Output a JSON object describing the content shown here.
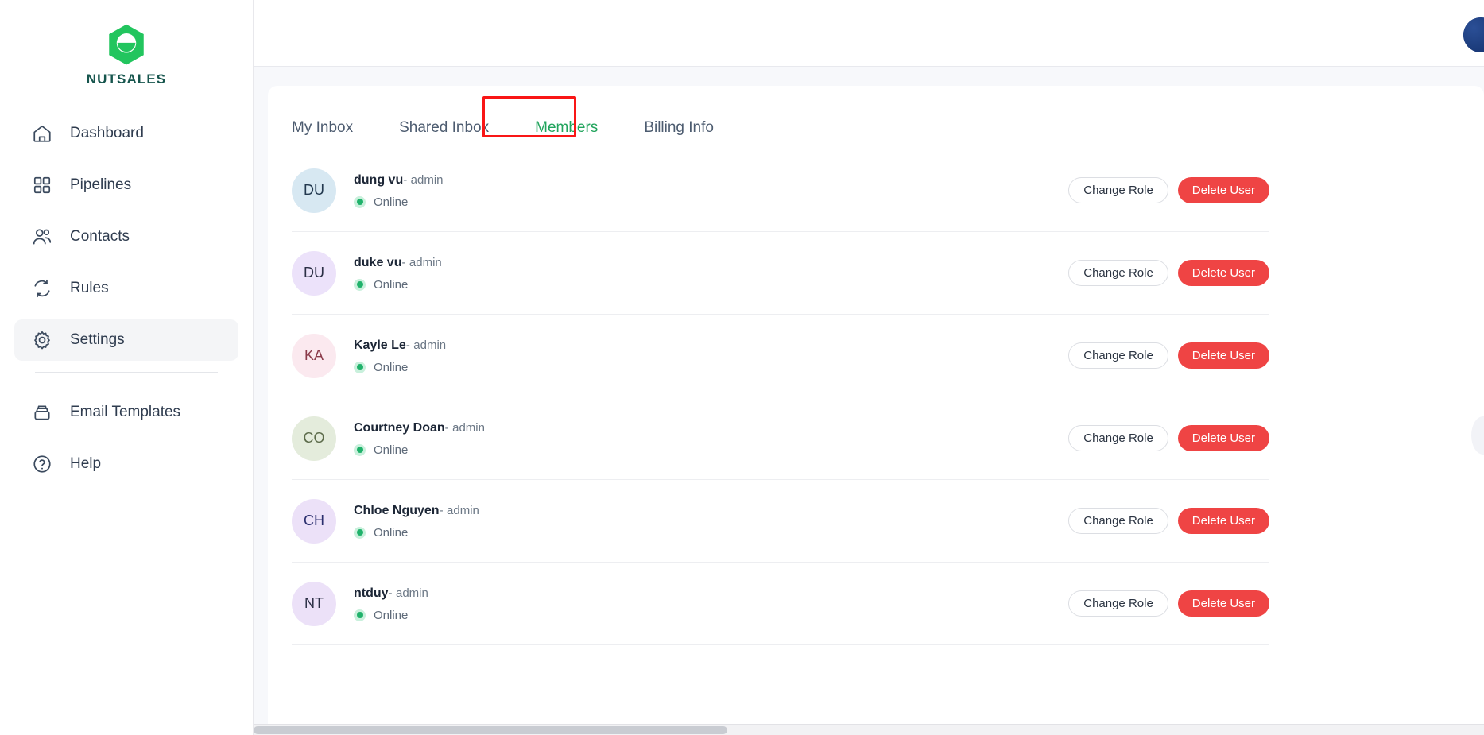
{
  "brand": {
    "name": "NUTSALES",
    "logo_icon": "nutsales-hexagon-logo",
    "accent_color": "#22c55e",
    "wordmark_color": "#16554d"
  },
  "sidebar": {
    "items": [
      {
        "label": "Dashboard",
        "icon": "home-icon",
        "active": false
      },
      {
        "label": "Pipelines",
        "icon": "grid-icon",
        "active": false
      },
      {
        "label": "Contacts",
        "icon": "people-icon",
        "active": false
      },
      {
        "label": "Rules",
        "icon": "refresh-icon",
        "active": false
      },
      {
        "label": "Settings",
        "icon": "gear-icon",
        "active": true
      }
    ],
    "secondary_items": [
      {
        "label": "Email Templates",
        "icon": "inbox-icon",
        "active": false
      },
      {
        "label": "Help",
        "icon": "question-circle-icon",
        "active": false
      }
    ]
  },
  "topbar": {
    "user_avatar_icon": "user-avatar",
    "user_avatar_color": "#1b3a7a"
  },
  "tabs": [
    {
      "label": "My Inbox",
      "active": false
    },
    {
      "label": "Shared Inbox",
      "active": false
    },
    {
      "label": "Members",
      "active": true
    },
    {
      "label": "Billing Info",
      "active": false
    }
  ],
  "annotation": {
    "target_tab": "Members",
    "color": "#f91616",
    "shape": "rectangle"
  },
  "actions": {
    "change_role_label": "Change Role",
    "delete_user_label": "Delete User",
    "delete_color": "#ef4444"
  },
  "status": {
    "online_label": "Online",
    "online_color": "#20b26b",
    "online_halo_color": "#c9f0dc"
  },
  "members": [
    {
      "initials": "DU",
      "name": "dung vu",
      "role_separator": "-",
      "role": "admin",
      "status": "Online",
      "avatar_bg": "#d7e8f2",
      "avatar_fg": "#23394f"
    },
    {
      "initials": "DU",
      "name": "duke vu",
      "role_separator": "-",
      "role": "admin",
      "status": "Online",
      "avatar_bg": "#ece2fa",
      "avatar_fg": "#2b2f45"
    },
    {
      "initials": "KA",
      "name": "Kayle Le",
      "role_separator": "-",
      "role": "admin",
      "status": "Online",
      "avatar_bg": "#fbe9ef",
      "avatar_fg": "#8b3a4a"
    },
    {
      "initials": "CO",
      "name": "Courtney Doan",
      "role_separator": "-",
      "role": "admin",
      "status": "Online",
      "avatar_bg": "#e4ecdc",
      "avatar_fg": "#5c6b4a"
    },
    {
      "initials": "CH",
      "name": "Chloe Nguyen",
      "role_separator": "-",
      "role": "admin",
      "status": "Online",
      "avatar_bg": "#ece1f8",
      "avatar_fg": "#2b2f6e"
    },
    {
      "initials": "NT",
      "name": "ntduy",
      "role_separator": "-",
      "role": "admin",
      "status": "Online",
      "avatar_bg": "#ece1f8",
      "avatar_fg": "#2b2f45"
    }
  ]
}
